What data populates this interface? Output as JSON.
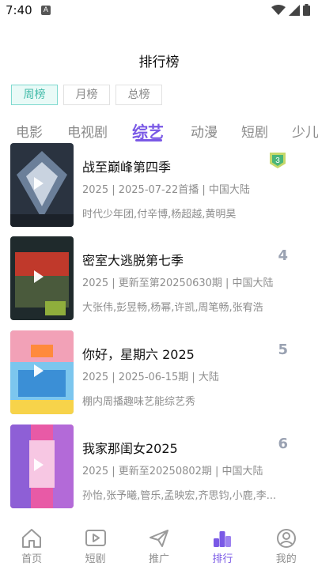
{
  "status_bar": {
    "time": "7:40",
    "notification": "A"
  },
  "page_title": "排行榜",
  "period_tabs": [
    {
      "label": "周榜",
      "active": true
    },
    {
      "label": "月榜",
      "active": false
    },
    {
      "label": "总榜",
      "active": false
    }
  ],
  "categories": [
    {
      "label": "电影",
      "active": false
    },
    {
      "label": "电视剧",
      "active": false
    },
    {
      "label": "综艺",
      "active": true
    },
    {
      "label": "动漫",
      "active": false
    },
    {
      "label": "短剧",
      "active": false
    },
    {
      "label": "少儿",
      "active": false
    }
  ],
  "items": [
    {
      "title": "战至巅峰第四季",
      "meta": "2025 | 2025-07-22首播 | 中国大陆",
      "cast": "时代少年团,付辛博,杨超越,黄明昊",
      "rank": "3",
      "rank_style": "badge",
      "poster_colors": [
        "#2a3340",
        "#6b7f99",
        "#c9d3e0"
      ]
    },
    {
      "title": "密室大逃脱第七季",
      "meta": "2025 | 更新至第20250630期 | 中国大陆",
      "cast": "大张伟,彭昱畅,杨幂,许凯,周笔畅,张宥浩",
      "rank": "4",
      "rank_style": "number",
      "poster_colors": [
        "#1f2a2c",
        "#c0392b",
        "#4a5a3c"
      ]
    },
    {
      "title": "你好，星期六 2025",
      "meta": "2025 | 2025-06-15期 | 大陆",
      "cast": "棚内周播趣味艺能综艺秀",
      "rank": "5",
      "rank_style": "number",
      "poster_colors": [
        "#f2a1b7",
        "#7cc6ee",
        "#ff8a3c"
      ]
    },
    {
      "title": "我家那闺女2025",
      "meta": "2025 | 更新至20250802期 | 中国大陆",
      "cast": "孙怡,张予曦,管乐,孟映宏,齐思钧,小鹿,李...",
      "rank": "6",
      "rank_style": "number",
      "poster_colors": [
        "#e85aa6",
        "#8e5fd6",
        "#f7c7e3"
      ]
    }
  ],
  "bottom_nav": [
    {
      "label": "首页",
      "icon": "home-icon",
      "active": false
    },
    {
      "label": "短剧",
      "icon": "video-play-icon",
      "active": false
    },
    {
      "label": "推广",
      "icon": "paper-plane-icon",
      "active": false
    },
    {
      "label": "排行",
      "icon": "ranking-icon",
      "active": true
    },
    {
      "label": "我的",
      "icon": "user-icon",
      "active": false
    }
  ],
  "colors": {
    "accent": "#7a59e6",
    "tab_active": "#43bba9"
  }
}
